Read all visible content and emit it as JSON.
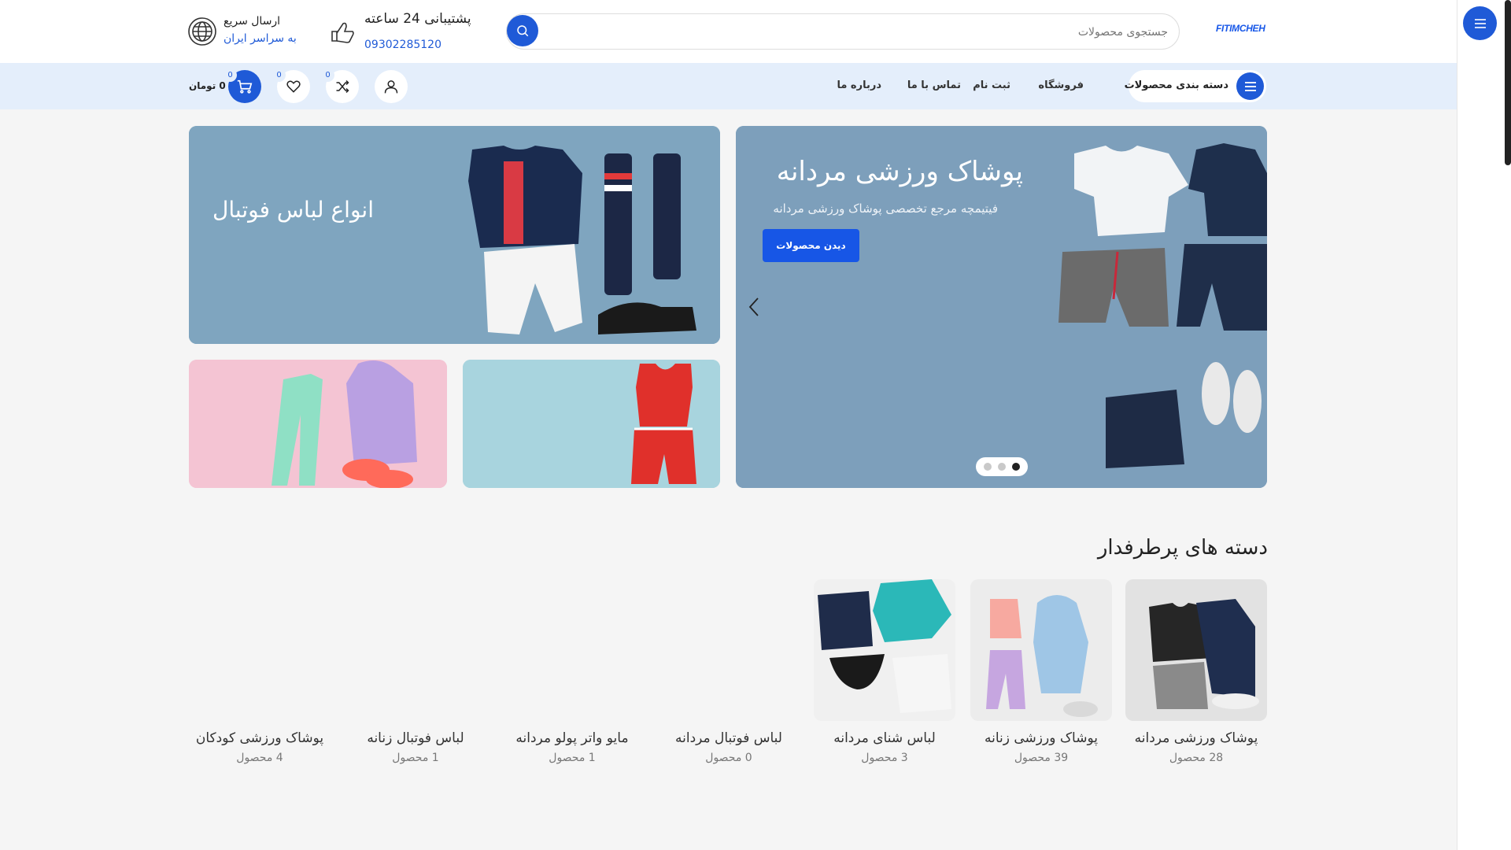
{
  "header": {
    "logo": "FITIMCHEH",
    "search_placeholder": "جستجوی محصولات",
    "support_title": "پشتیبانی 24 ساعته",
    "support_phone": "09302285120",
    "shipping_title": "ارسال سریع",
    "shipping_sub": "به سراسر ایران"
  },
  "nav": {
    "categories_button": "دسته بندی محصولات",
    "links": [
      "فروشگاه",
      "ثبت نام",
      "تماس با ما",
      "درباره ما"
    ],
    "compare_count": "0",
    "wishlist_count": "0",
    "cart_count": "0",
    "cart_total": "0 تومان"
  },
  "hero": {
    "main_title": "پوشاک ورزشی مردانه",
    "main_subtitle": "فیتیمچه مرجع تخصصی پوشاک ورزشی مردانه",
    "main_cta": "دیدن محصولات",
    "slides": 3,
    "active_slide": 1,
    "football_title": "انواع لباس فوتبال"
  },
  "popular": {
    "title": "دسته های پرطرفدار",
    "categories": [
      {
        "name": "پوشاک ورزشی مردانه",
        "count": "28 محصول"
      },
      {
        "name": "پوشاک ورزشی زنانه",
        "count": "39 محصول"
      },
      {
        "name": "لباس شنای مردانه",
        "count": "3 محصول"
      },
      {
        "name": "لباس فوتبال مردانه",
        "count": "0 محصول"
      },
      {
        "name": "مایو واتر پولو مردانه",
        "count": "1 محصول"
      },
      {
        "name": "لباس فوتبال زنانه",
        "count": "1 محصول"
      },
      {
        "name": "پوشاک ورزشی کودکان",
        "count": "4 محصول"
      }
    ]
  },
  "colors": {
    "primary": "#1f5ad7",
    "nav_bg": "#e4eefb"
  }
}
